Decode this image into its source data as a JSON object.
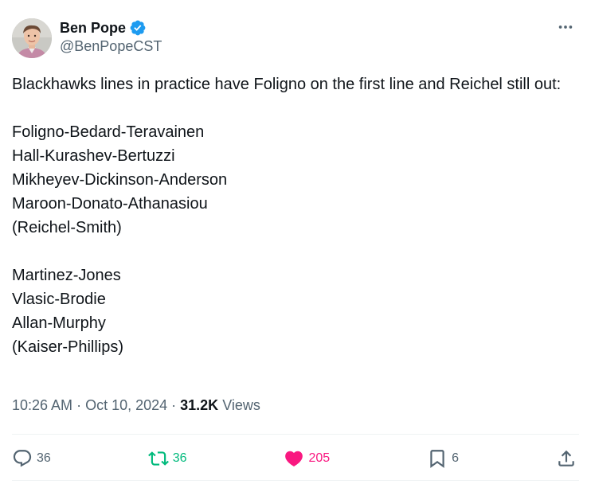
{
  "author": {
    "display_name": "Ben Pope",
    "handle": "@BenPopeCST",
    "verified_color": "#1d9bf0"
  },
  "tweet": {
    "lines": [
      "Blackhawks lines in practice have Foligno on the first line and Reichel still out:",
      "",
      "Foligno-Bedard-Teravainen",
      "Hall-Kurashev-Bertuzzi",
      "Mikheyev-Dickinson-Anderson",
      "Maroon-Donato-Athanasiou",
      "(Reichel-Smith)",
      "",
      "Martinez-Jones",
      "Vlasic-Brodie",
      "Allan-Murphy",
      "(Kaiser-Phillips)"
    ]
  },
  "meta": {
    "time": "10:26 AM",
    "separator": "·",
    "date": "Oct 10, 2024",
    "views_count": "31.2K",
    "views_label": "Views"
  },
  "actions": {
    "replies": "36",
    "retweets": "36",
    "likes": "205",
    "bookmarks": "6"
  },
  "colors": {
    "text": "#0f1419",
    "secondary": "#536471",
    "retweet": "#00ba7c",
    "like": "#f91880"
  },
  "icons": [
    "more-icon",
    "reply-icon",
    "retweet-icon",
    "like-icon",
    "bookmark-icon",
    "share-icon",
    "verified-badge-icon"
  ]
}
